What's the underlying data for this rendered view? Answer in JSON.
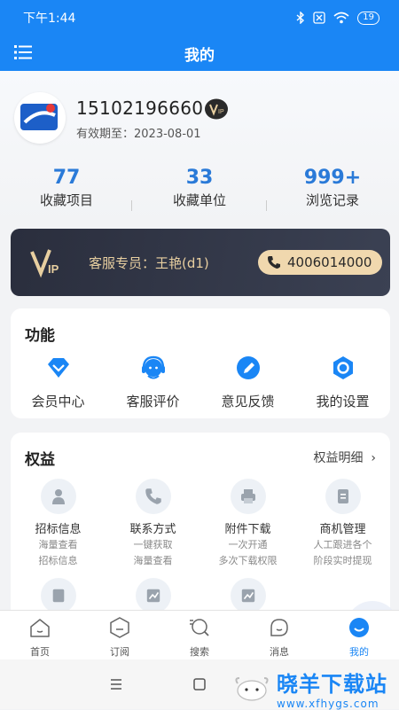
{
  "status_bar": {
    "time": "下午1:44",
    "battery": "19"
  },
  "header": {
    "title": "我的"
  },
  "profile": {
    "phone": "15102196660",
    "expire": "有效期至：2023-08-01"
  },
  "stats": [
    {
      "value": "77",
      "label": "收藏项目"
    },
    {
      "value": "33",
      "label": "收藏单位"
    },
    {
      "value": "999+",
      "label": "浏览记录"
    }
  ],
  "vip_card": {
    "agent": "客服专员：王艳(d1)",
    "hotline": "4006014000"
  },
  "functions": {
    "title": "功能",
    "items": [
      {
        "label": "会员中心",
        "icon": "diamond-icon"
      },
      {
        "label": "客服评价",
        "icon": "headset-icon"
      },
      {
        "label": "意见反馈",
        "icon": "pencil-icon"
      },
      {
        "label": "我的设置",
        "icon": "gear-icon"
      }
    ]
  },
  "benefits": {
    "title": "权益",
    "more": "权益明细",
    "items": [
      {
        "name": "招标信息",
        "desc1": "海量查看",
        "desc2": "招标信息",
        "icon": "user-icon"
      },
      {
        "name": "联系方式",
        "desc1": "一键获取",
        "desc2": "海量查看",
        "icon": "phone-icon"
      },
      {
        "name": "附件下载",
        "desc1": "一次开通",
        "desc2": "多次下载权限",
        "icon": "printer-icon"
      },
      {
        "name": "商机管理",
        "desc1": "人工跟进各个",
        "desc2": "阶段实时提现",
        "icon": "document-icon"
      }
    ]
  },
  "tabs": [
    {
      "label": "首页",
      "icon": "home-icon"
    },
    {
      "label": "订阅",
      "icon": "subscribe-icon"
    },
    {
      "label": "搜索",
      "icon": "search-icon"
    },
    {
      "label": "消息",
      "icon": "message-icon"
    },
    {
      "label": "我的",
      "icon": "profile-icon"
    }
  ],
  "watermark": {
    "title": "晓羊下载站",
    "url": "www.xfhygs.com"
  },
  "colors": {
    "primary": "#1a86f5",
    "vip_gold": "#f0d8ae",
    "vip_dark": "#2a2e3d"
  }
}
